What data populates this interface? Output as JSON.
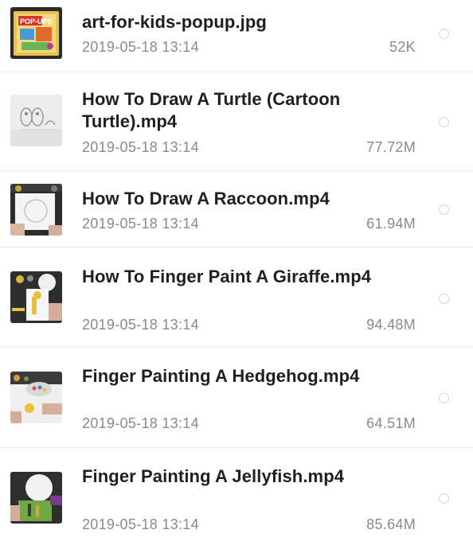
{
  "files": [
    {
      "name": "art-for-kids-popup.jpg",
      "date": "2019-05-18 13:14",
      "size": "52K",
      "thumb": "popup-book-thumbnail"
    },
    {
      "name": "How To Draw A Turtle (Cartoon Turtle).mp4",
      "date": "2019-05-18 13:14",
      "size": "77.72M",
      "thumb": "turtle-sketch-thumbnail"
    },
    {
      "name": "How To Draw A Raccoon.mp4",
      "date": "2019-05-18 13:14",
      "size": "61.94M",
      "thumb": "raccoon-drawing-thumbnail"
    },
    {
      "name": "How To Finger Paint A Giraffe.mp4",
      "date": "2019-05-18 13:14",
      "size": "94.48M",
      "thumb": "giraffe-painting-thumbnail"
    },
    {
      "name": "Finger Painting A Hedgehog.mp4",
      "date": "2019-05-18 13:14",
      "size": "64.51M",
      "thumb": "hedgehog-painting-thumbnail"
    },
    {
      "name": "Finger Painting A Jellyfish.mp4",
      "date": "2019-05-18 13:14",
      "size": "85.64M",
      "thumb": "jellyfish-painting-thumbnail"
    }
  ],
  "colors": {
    "name_text": "#1f1f1f",
    "meta_text": "#8a8a8a",
    "divider": "#e9e9e9",
    "radio_border": "#d4d4d4"
  }
}
